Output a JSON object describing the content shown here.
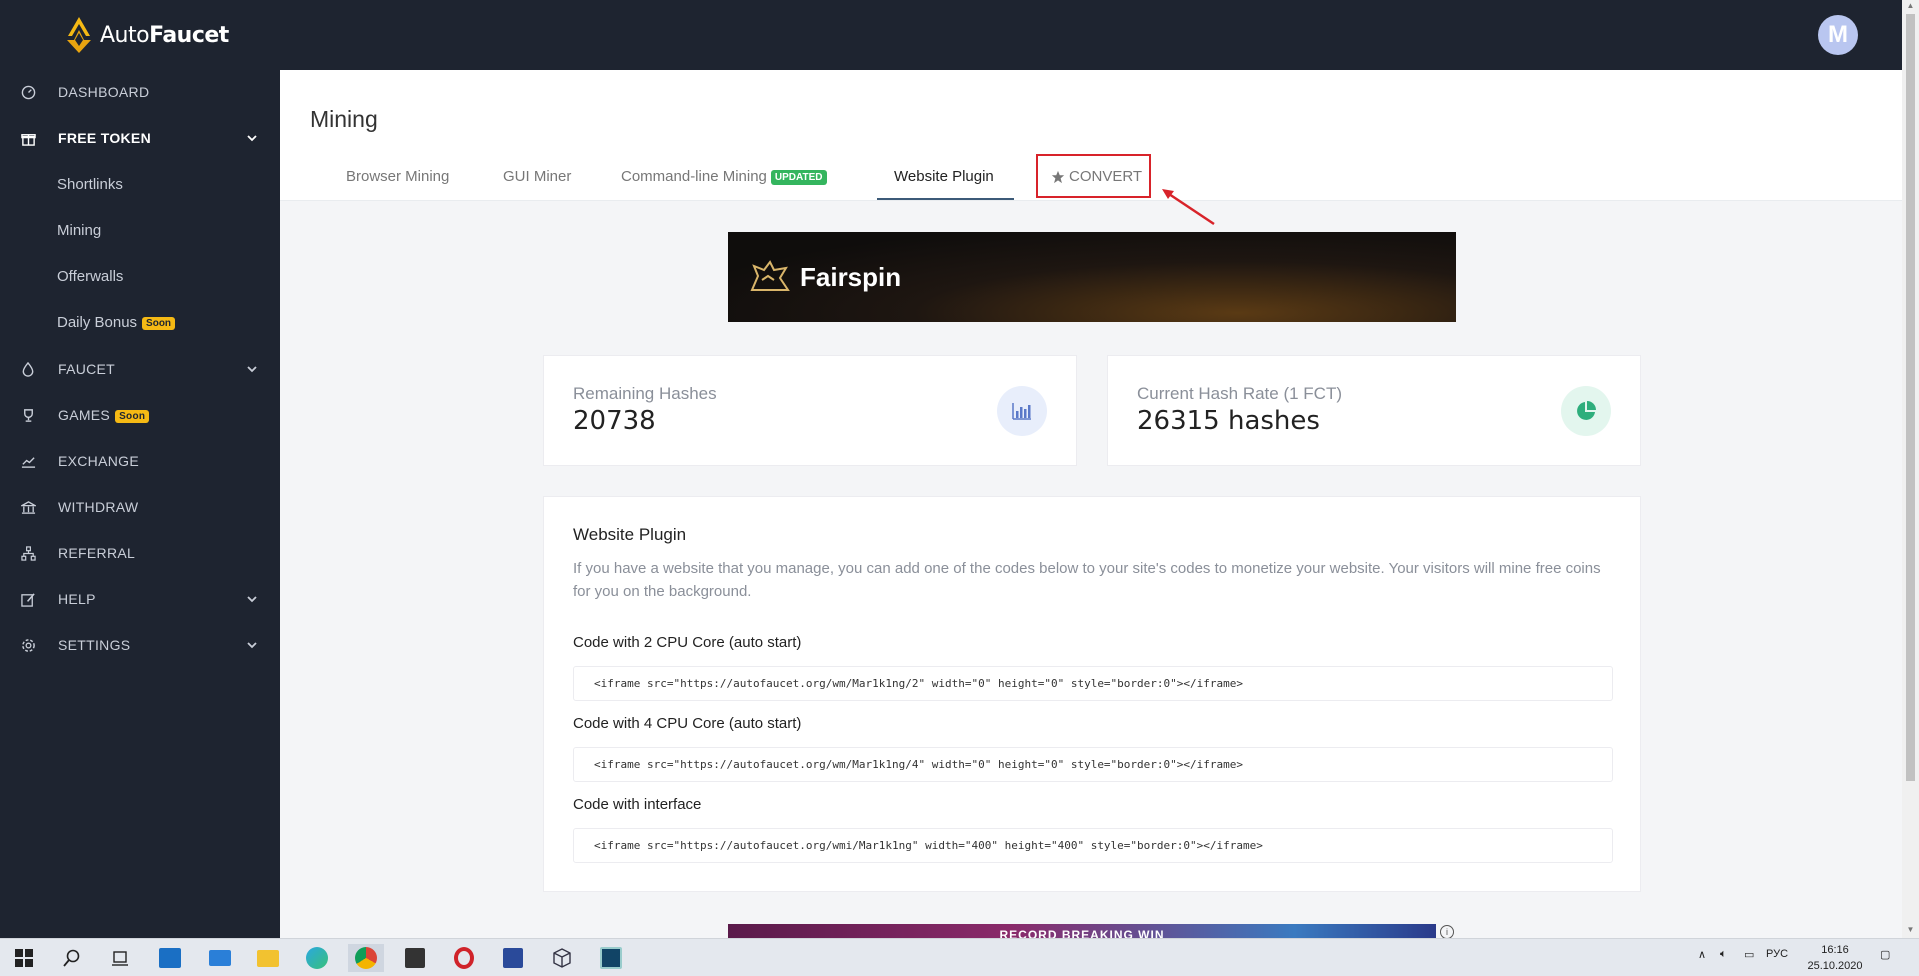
{
  "app": {
    "brand_prefix": "Auto",
    "brand_suffix": "Faucet",
    "avatar_initial": "M"
  },
  "sidebar": {
    "dashboard": "DASHBOARD",
    "free_token": "FREE TOKEN",
    "shortlinks": "Shortlinks",
    "mining": "Mining",
    "offerwalls": "Offerwalls",
    "daily_bonus": "Daily Bonus",
    "soon": "Soon",
    "faucet": "FAUCET",
    "games": "GAMES",
    "exchange": "EXCHANGE",
    "withdraw": "WITHDRAW",
    "referral": "REFERRAL",
    "help": "HELP",
    "settings": "SETTINGS"
  },
  "page": {
    "title": "Mining",
    "tabs": {
      "browser": "Browser Mining",
      "gui": "GUI Miner",
      "cli": "Command-line Mining",
      "cli_badge": "UPDATED",
      "plugin": "Website Plugin",
      "convert": "CONVERT"
    }
  },
  "banner": {
    "brand": "Fairspin"
  },
  "stats": {
    "remaining_label": "Remaining Hashes",
    "remaining_value": "20738",
    "rate_label": "Current Hash Rate (1 FCT)",
    "rate_value": "26315 hashes"
  },
  "plugin": {
    "title": "Website Plugin",
    "description": "If you have a website that you manage, you can add one of the codes below to your site's codes to monetize your website. Your visitors will mine free coins for you on the background.",
    "code1_label": "Code with 2 CPU Core (auto start)",
    "code1": "<iframe src=\"https://autofaucet.org/wm/Mar1k1ng/2\" width=\"0\" height=\"0\" style=\"border:0\"></iframe>",
    "code2_label": "Code with 4 CPU Core (auto start)",
    "code2": "<iframe src=\"https://autofaucet.org/wm/Mar1k1ng/4\" width=\"0\" height=\"0\" style=\"border:0\"></iframe>",
    "code3_label": "Code with interface",
    "code3": "<iframe src=\"https://autofaucet.org/wmi/Mar1k1ng\" width=\"400\" height=\"400\" style=\"border:0\"></iframe>"
  },
  "ad": {
    "text": "RECORD BREAKING WIN"
  },
  "taskbar": {
    "lang": "РУС",
    "time": "16:16",
    "date": "25.10.2020"
  },
  "colors": {
    "sidebar_bg": "#1e2430",
    "accent_badge": "#f5b914",
    "updated_badge": "#34b55e",
    "highlight_box": "#d8232a"
  }
}
